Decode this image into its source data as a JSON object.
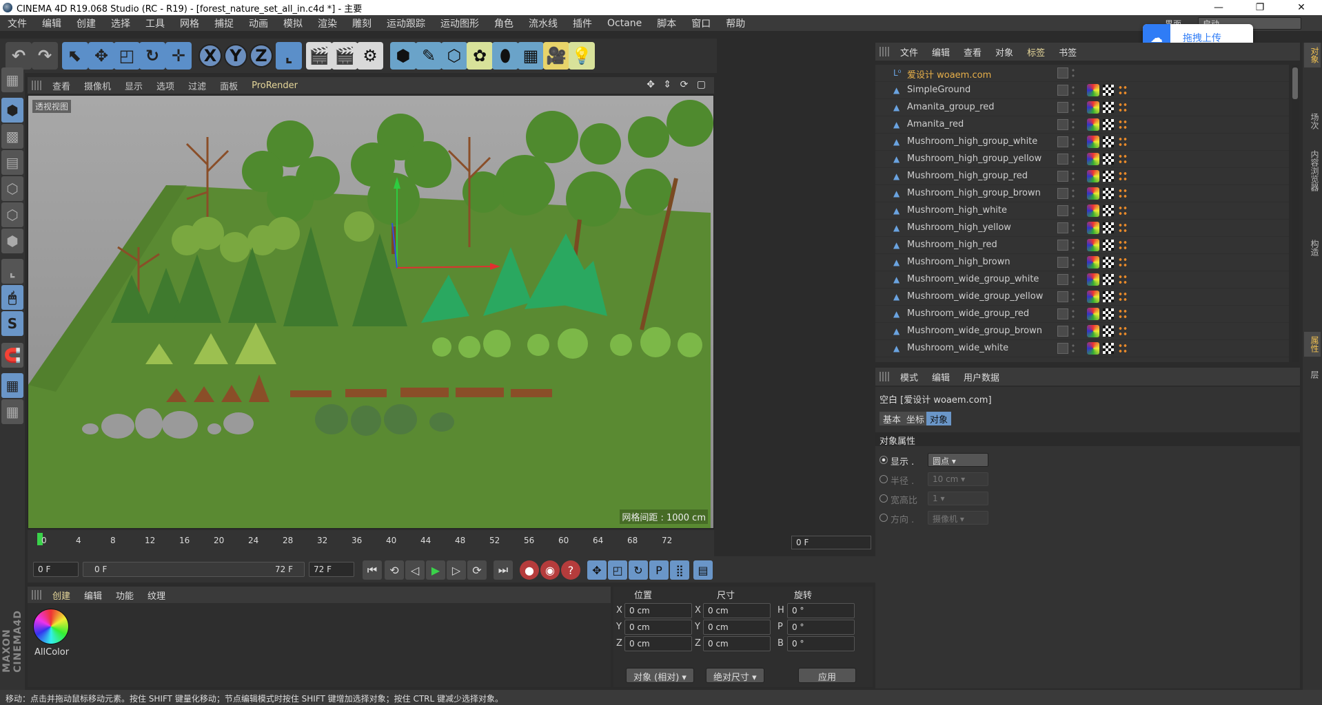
{
  "window": {
    "title": "CINEMA 4D R19.068 Studio (RC - R19) - [forest_nature_set_all_in.c4d *] - 主要",
    "controls": [
      "—",
      "❐",
      "✕"
    ]
  },
  "menubar": {
    "items": [
      "文件",
      "编辑",
      "创建",
      "选择",
      "工具",
      "网格",
      "捕捉",
      "动画",
      "模拟",
      "渲染",
      "雕刻",
      "运动跟踪",
      "运动图形",
      "角色",
      "流水线",
      "插件",
      "Octane",
      "脚本",
      "窗口",
      "帮助"
    ],
    "layout_label": "界面",
    "layout_value": "启动"
  },
  "upload_widget": {
    "label": "拖拽上传"
  },
  "viewport": {
    "menu": [
      "查看",
      "摄像机",
      "显示",
      "选项",
      "过滤",
      "面板",
      "ProRender"
    ],
    "nav_icons": "✥ ⇕ ⟳ ▢",
    "label": "透视视图",
    "grid_spacing": "网格间距 : 1000 cm"
  },
  "timeline": {
    "ticks": [
      "0",
      "4",
      "8",
      "12",
      "16",
      "20",
      "24",
      "28",
      "32",
      "36",
      "40",
      "44",
      "48",
      "52",
      "56",
      "60",
      "64",
      "68",
      "72"
    ],
    "current_frame": "0 F",
    "start": "0 F",
    "range_start": "0 F",
    "range_end": "72 F",
    "end": "72 F"
  },
  "material_manager": {
    "menu": [
      "创建",
      "编辑",
      "功能",
      "纹理"
    ],
    "materials": [
      {
        "name": "AllColor"
      }
    ]
  },
  "coordinates": {
    "headers": {
      "position": "位置",
      "size": "尺寸",
      "rotation": "旋转"
    },
    "rows": [
      {
        "axis": "X",
        "pos": "0 cm",
        "size_axis": "X",
        "size": "0 cm",
        "rot_axis": "H",
        "rot": "0 °"
      },
      {
        "axis": "Y",
        "pos": "0 cm",
        "size_axis": "Y",
        "size": "0 cm",
        "rot_axis": "P",
        "rot": "0 °"
      },
      {
        "axis": "Z",
        "pos": "0 cm",
        "size_axis": "Z",
        "size": "0 cm",
        "rot_axis": "B",
        "rot": "0 °"
      }
    ],
    "mode": "对象 (相对)",
    "size_mode": "绝对尺寸",
    "apply": "应用"
  },
  "object_manager": {
    "menu": [
      "文件",
      "编辑",
      "查看",
      "对象",
      "标签",
      "书签"
    ],
    "objects": [
      {
        "name": "爱设计 woaem.com",
        "highlight": true
      },
      {
        "name": "SimpleGround"
      },
      {
        "name": "Amanita_group_red"
      },
      {
        "name": "Amanita_red"
      },
      {
        "name": "Mushroom_high_group_white"
      },
      {
        "name": "Mushroom_high_group_yellow"
      },
      {
        "name": "Mushroom_high_group_red"
      },
      {
        "name": "Mushroom_high_group_brown"
      },
      {
        "name": "Mushroom_high_white"
      },
      {
        "name": "Mushroom_high_yellow"
      },
      {
        "name": "Mushroom_high_red"
      },
      {
        "name": "Mushroom_high_brown"
      },
      {
        "name": "Mushroom_wide_group_white"
      },
      {
        "name": "Mushroom_wide_group_yellow"
      },
      {
        "name": "Mushroom_wide_group_red"
      },
      {
        "name": "Mushroom_wide_group_brown"
      },
      {
        "name": "Mushroom_wide_white"
      }
    ]
  },
  "right_tabs": [
    "对象",
    "场次",
    "内容浏览器",
    "构造",
    "属性",
    "层"
  ],
  "attribute_manager": {
    "menu": [
      "模式",
      "编辑",
      "用户数据"
    ],
    "object_title": "空白 [爱设计 woaem.com]",
    "tabs": [
      "基本",
      "坐标",
      "对象"
    ],
    "section": "对象属性",
    "props": [
      {
        "label": "显示 .",
        "value": "圆点",
        "enabled": true
      },
      {
        "label": "半径 .",
        "value": "10 cm",
        "enabled": false
      },
      {
        "label": "宽高比",
        "value": "1",
        "enabled": false
      },
      {
        "label": "方向 .",
        "value": "摄像机",
        "enabled": false
      }
    ]
  },
  "statusbar": {
    "text": "移动：点击并拖动鼠标移动元素。按住 SHIFT 键量化移动；节点编辑模式时按住 SHIFT 键增加选择对象；按住 CTRL 键减少选择对象。"
  },
  "colors": {
    "accent": "#e6d79a",
    "selection_blue": "#6a96c8",
    "ground_green": "#5a8a32",
    "upload_blue": "#2f7cf6"
  }
}
